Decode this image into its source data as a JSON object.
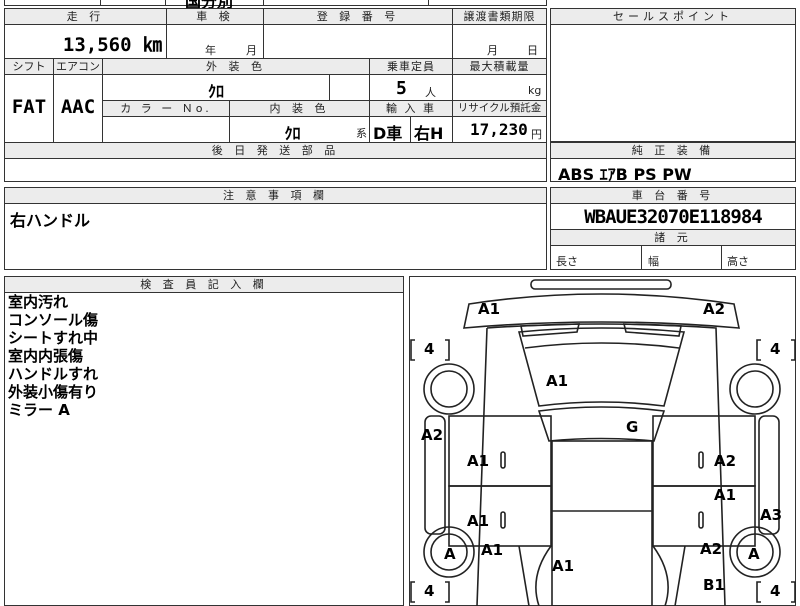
{
  "top": {
    "fragment": "国分別"
  },
  "main_grid": {
    "mileage_label": "走 行",
    "mileage_value": "13,560 ㎞",
    "inspection_label": "車 検",
    "inspection_year": "年",
    "inspection_month": "月",
    "registration_label": "登 録 番 号",
    "transfer_label": "譲渡書類期限",
    "transfer_month": "月",
    "transfer_day": "日",
    "shift_label": "シフト",
    "shift_value": "FAT",
    "ac_label": "エアコン",
    "ac_value": "AAC",
    "exterior_label": "外 装 色",
    "exterior_value": "ｸﾛ",
    "capacity_label": "乗車定員",
    "capacity_value": "5",
    "capacity_unit": "人",
    "load_label": "最大積載量",
    "load_unit": "kg",
    "color_no_label": "カ ラ ー Ｎo.",
    "interior_label": "内 装 色",
    "interior_value": "ｸﾛ",
    "interior_suffix": "系",
    "import_label": "輸 入 車",
    "import_dealer": "D車",
    "import_handle": "右H",
    "recycle_label": "リサイクル預託金",
    "recycle_value": "17,230",
    "recycle_unit": "円",
    "later_parts_label": "後 日 発 送 部 品"
  },
  "sales_point": {
    "label": "セールスポイント"
  },
  "equipment": {
    "label": "純 正 装 備",
    "value": "ABS ｴｱB PS PW"
  },
  "notes": {
    "label": "注 意 事 項 欄",
    "value": "右ハンドル"
  },
  "chassis": {
    "label": "車 台 番 号",
    "value": "WBAUE32070E118984"
  },
  "dimensions": {
    "label": "諸 元",
    "length": "長さ",
    "width": "幅",
    "height": "高さ"
  },
  "inspector": {
    "label": "検 査 員 記 入 欄",
    "lines": [
      "室内汚れ",
      "コンソール傷",
      "シートすれ中",
      "室内内張傷",
      "ハンドルすれ",
      "外装小傷有り",
      "ミラー A"
    ]
  },
  "diagram": {
    "marks": {
      "front_left": "A1",
      "front_right": "A2",
      "hood": "A1",
      "windshield": "G",
      "left_fender": "A2",
      "left_front_door": "A1",
      "left_rear_door": "A1",
      "left_rear_quarter": "A1",
      "right_front_door": "A2",
      "right_mid": "A1",
      "right_quarter": "A3",
      "right_rear": "A2",
      "roof_rear": "A1",
      "rear_right": "B1",
      "left_mirror": "A",
      "right_mirror": "A"
    },
    "tyres": {
      "front_left": "4",
      "front_right": "4",
      "rear_left": "4",
      "rear_right": "4"
    }
  }
}
